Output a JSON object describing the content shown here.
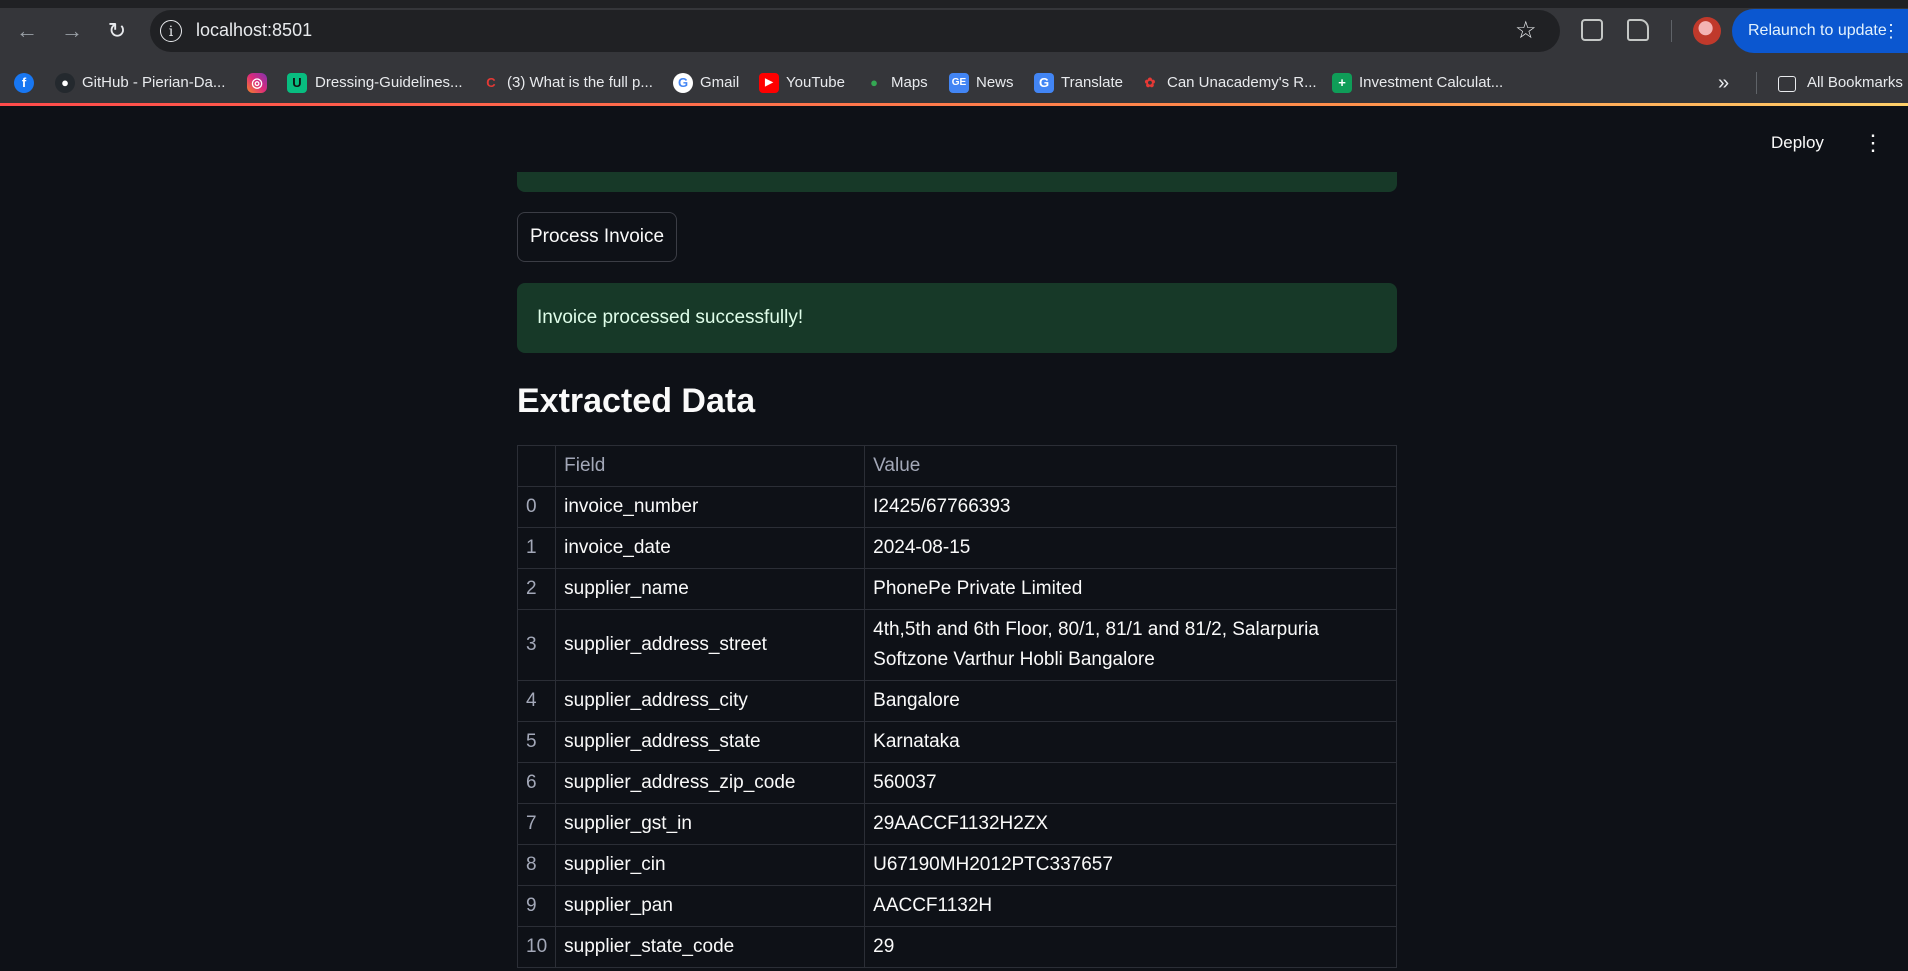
{
  "browser": {
    "url": "localhost:8501",
    "relaunch_label": "Relaunch to update",
    "bookmarks": [
      "GitHub - Pierian-Da...",
      "Dressing-Guidelines...",
      "(3) What is the full p...",
      "Gmail",
      "YouTube",
      "Maps",
      "News",
      "Translate",
      "Can Unacademy's R...",
      "Investment Calculat..."
    ],
    "all_bookmarks": "All Bookmarks"
  },
  "app": {
    "deploy_label": "Deploy",
    "process_button": "Process Invoice",
    "success_message": "Invoice processed successfully!",
    "heading": "Extracted Data",
    "table": {
      "columns": [
        "Field",
        "Value"
      ],
      "rows": [
        {
          "index": "0",
          "field": "invoice_number",
          "value": "I2425/67766393"
        },
        {
          "index": "1",
          "field": "invoice_date",
          "value": "2024-08-15"
        },
        {
          "index": "2",
          "field": "supplier_name",
          "value": "PhonePe Private Limited"
        },
        {
          "index": "3",
          "field": "supplier_address_street",
          "value": "4th,5th and 6th Floor, 80/1, 81/1 and 81/2, Salarpuria Softzone Varthur Hobli Bangalore"
        },
        {
          "index": "4",
          "field": "supplier_address_city",
          "value": "Bangalore"
        },
        {
          "index": "5",
          "field": "supplier_address_state",
          "value": "Karnataka"
        },
        {
          "index": "6",
          "field": "supplier_address_zip_code",
          "value": "560037"
        },
        {
          "index": "7",
          "field": "supplier_gst_in",
          "value": "29AACCF1132H2ZX"
        },
        {
          "index": "8",
          "field": "supplier_cin",
          "value": "U67190MH2012PTC337657"
        },
        {
          "index": "9",
          "field": "supplier_pan",
          "value": "AACCF1132H"
        },
        {
          "index": "10",
          "field": "supplier_state_code",
          "value": "29"
        }
      ]
    }
  }
}
